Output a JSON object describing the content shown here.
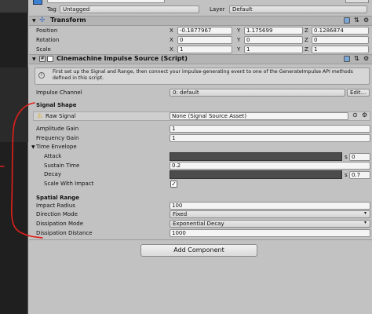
{
  "gameobject": {
    "tag_label": "Tag",
    "tag_value": "Untagged",
    "layer_label": "Layer",
    "layer_value": "Default"
  },
  "transform": {
    "title": "Transform",
    "position_label": "Position",
    "rotation_label": "Rotation",
    "scale_label": "Scale",
    "axis_x": "X",
    "axis_y": "Y",
    "axis_z": "Z",
    "position": [
      "-0.1877967",
      "1.175699",
      "0.1286874"
    ],
    "rotation": [
      "0",
      "0",
      "0"
    ],
    "scale": [
      "1",
      "1",
      "1"
    ]
  },
  "impulse": {
    "title": "Cinemachine Impulse Source (Script)",
    "info_text": "First set up the Signal and Range, then connect your impulse-generating event to one of the GenerateImpulse API methods defined in this script.",
    "channel_label": "Impulse Channel",
    "channel_value": "0: default",
    "edit_label": "Edit...",
    "signal_shape_header": "Signal Shape",
    "raw_signal_label": "Raw Signal",
    "raw_signal_value": "None (Signal Source Asset)",
    "amplitude_label": "Amplitude Gain",
    "amplitude_value": "1",
    "frequency_label": "Frequency Gain",
    "frequency_value": "1",
    "time_envelope_label": "Time Envelope",
    "attack_label": "Attack",
    "attack_suffix": "s",
    "attack_value": "0",
    "sustain_label": "Sustain Time",
    "sustain_value": "0.2",
    "decay_label": "Decay",
    "decay_suffix": "s",
    "decay_value": "0.7",
    "scale_impact_label": "Scale With Impact",
    "spatial_header": "Spatial Range",
    "impact_radius_label": "Impact Radius",
    "impact_radius_value": "100",
    "direction_mode_label": "Direction Mode",
    "direction_mode_value": "Fixed",
    "dissipation_mode_label": "Dissipation Mode",
    "dissipation_mode_value": "Exponential Decay",
    "dissipation_distance_label": "Dissipation Distance",
    "dissipation_distance_value": "1000"
  },
  "add_component_label": "Add Component",
  "colors": {
    "annotation": "#e0201a",
    "dark_bar": "#4c4c4c",
    "inspector_bg": "#c2c2c2"
  }
}
